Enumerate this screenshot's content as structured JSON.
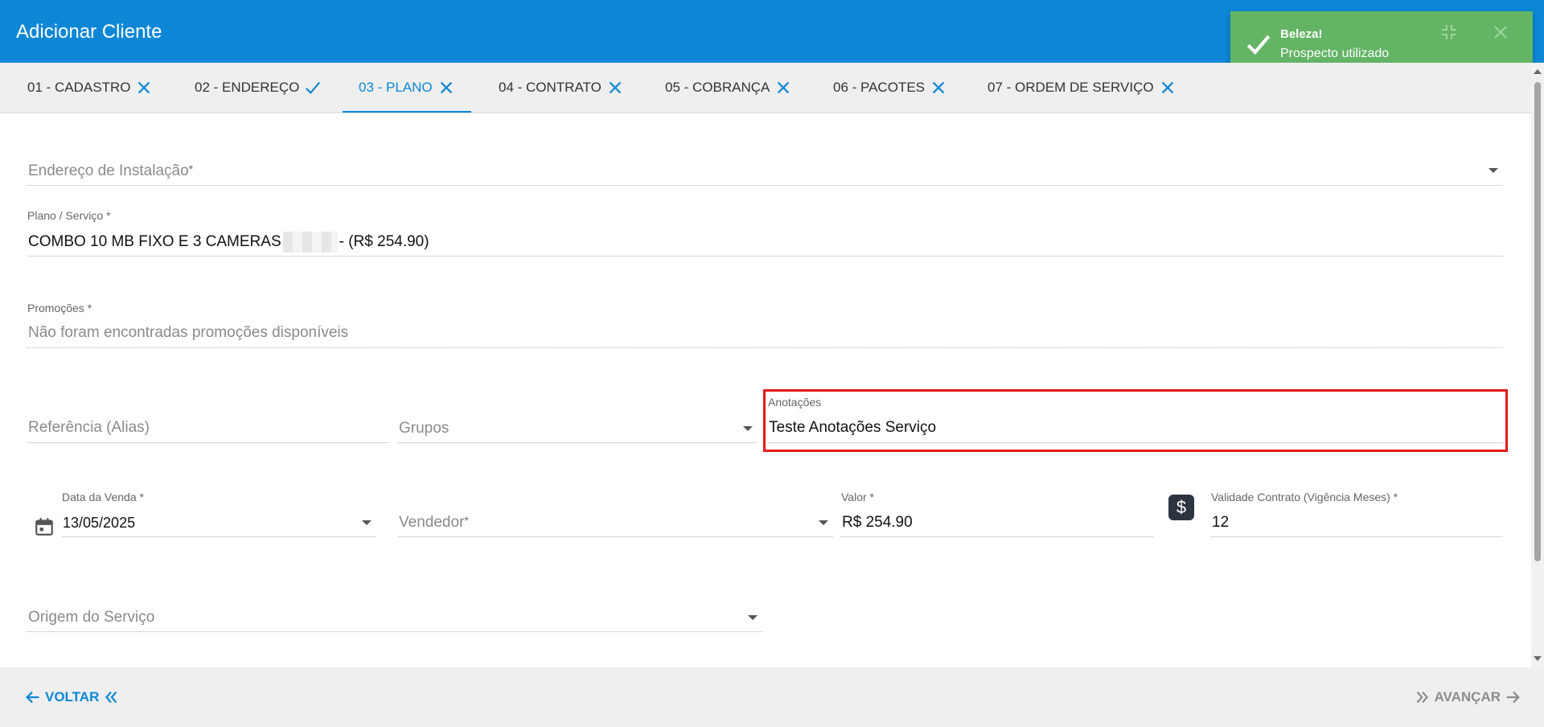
{
  "header": {
    "title": "Adicionar Cliente"
  },
  "toast": {
    "title": "Beleza!",
    "message": "Prospecto utilizado",
    "icon": "check-icon"
  },
  "tabs": [
    {
      "label": "01 - CADASTRO",
      "status": "x"
    },
    {
      "label": "02 - ENDEREÇO",
      "status": "check"
    },
    {
      "label": "03 - PLANO",
      "status": "x"
    },
    {
      "label": "04 - CONTRATO",
      "status": "x"
    },
    {
      "label": "05 - COBRANÇA",
      "status": "x"
    },
    {
      "label": "06 - PACOTES",
      "status": "x"
    },
    {
      "label": "07 - ORDEM DE SERVIÇO",
      "status": "x"
    }
  ],
  "active_tab": "03 - PLANO",
  "form": {
    "endereco": {
      "label": "Endereço de Instalação",
      "required": "*"
    },
    "plano": {
      "label": "Plano / Serviço",
      "required": "*",
      "value_prefix": "COMBO 10 MB FIXO E 3 CAMERAS",
      "value_suffix": "- (R$ 254.90)"
    },
    "promocoes": {
      "label": "Promoções",
      "required": "*",
      "value": "Não foram encontradas promoções disponíveis"
    },
    "referencia": {
      "label": "Referência (Alias)"
    },
    "grupos": {
      "label": "Grupos"
    },
    "anotacoes": {
      "label": "Anotações",
      "value": "Teste Anotações Serviço"
    },
    "data_venda": {
      "label": "Data da Venda",
      "required": "*",
      "value": "13/05/2025"
    },
    "vendedor": {
      "label": "Vendedor",
      "required": "*"
    },
    "valor": {
      "label": "Valor",
      "required": "*",
      "value": "R$ 254.90"
    },
    "validade": {
      "label": "Validade Contrato (Vigência Meses)",
      "required": "*",
      "value": "12"
    },
    "origem": {
      "label": "Origem do Serviço"
    }
  },
  "footer": {
    "back_label": "VOLTAR",
    "next_label": "AVANÇAR"
  },
  "colors": {
    "primary": "#0b87d6",
    "toast": "#63b465",
    "highlight": "#e31b1b"
  }
}
